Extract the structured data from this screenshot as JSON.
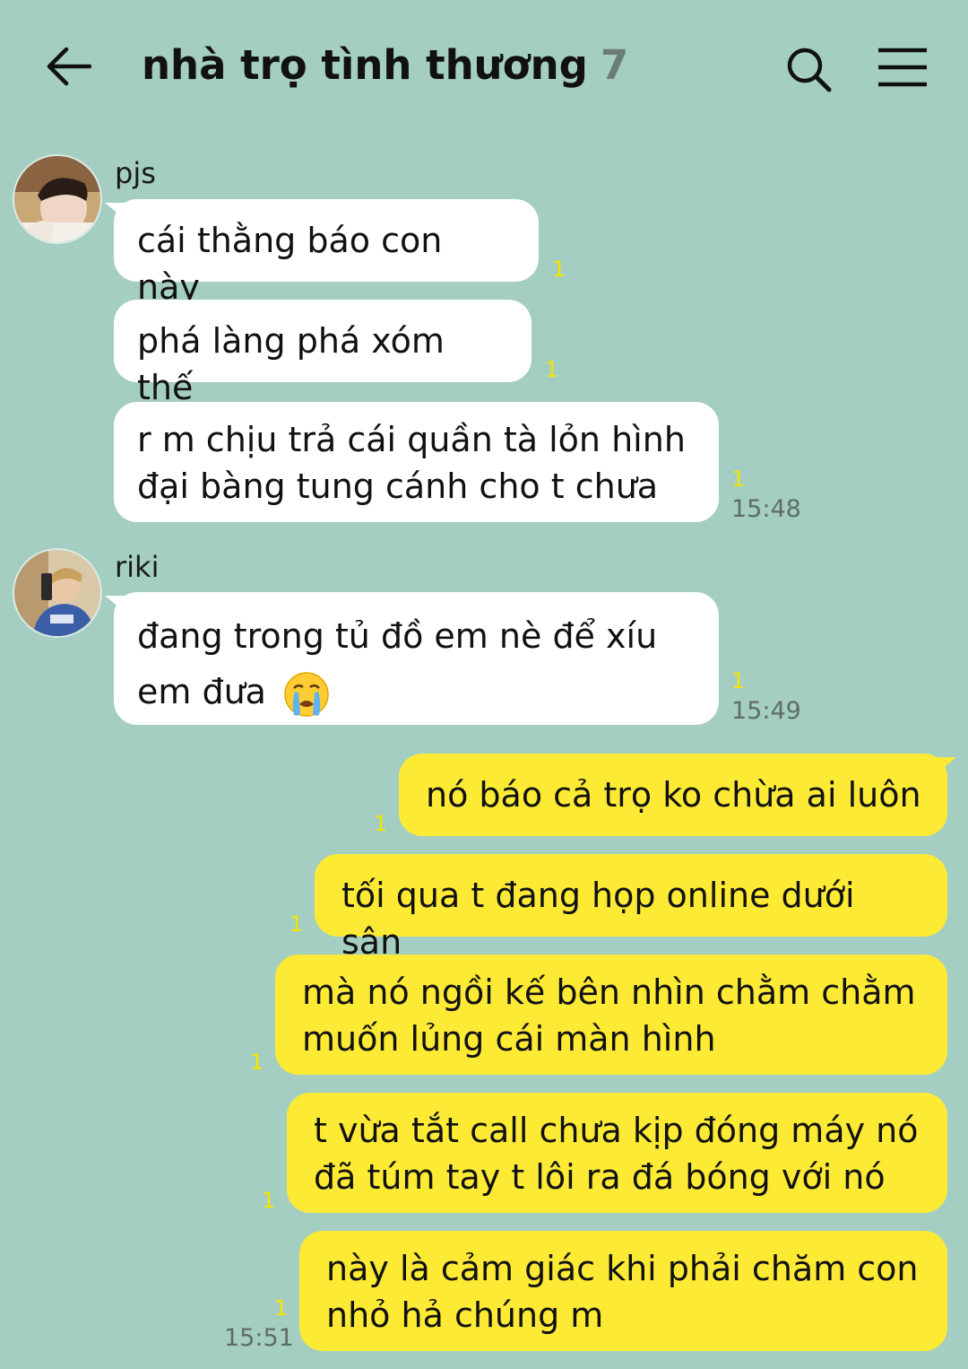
{
  "header": {
    "title": "nhà trọ tình thương",
    "member_count": "7",
    "back_icon": "arrow-left-icon",
    "search_icon": "search-icon",
    "menu_icon": "hamburger-menu-icon"
  },
  "colors": {
    "background": "#a4cec1",
    "incoming_bubble": "#ffffff",
    "outgoing_bubble": "#fdea35",
    "read_count": "#f5e400"
  },
  "senders": {
    "pjs": "pjs",
    "riki": "riki"
  },
  "messages": {
    "m1": {
      "text": "cái thằng báo con này",
      "read": "1"
    },
    "m2": {
      "text": "phá làng phá xóm thế",
      "read": "1"
    },
    "m3": {
      "line1": "r m chịu trả cái quần tà lỏn hình",
      "line2": "đại bàng tung cánh cho t chưa",
      "read": "1",
      "time": "15:48"
    },
    "m4": {
      "line1": "đang trong tủ đồ em nè để xíu",
      "line2": "em đưa",
      "emoji": "crying-face-emoji",
      "read": "1",
      "time": "15:49"
    },
    "m5": {
      "text": "nó báo cả trọ ko chừa ai luôn",
      "read": "1"
    },
    "m6": {
      "text": "tối qua t đang họp online dưới sân",
      "read": "1"
    },
    "m7": {
      "line1": "mà nó ngồi kế bên nhìn chằm chằm",
      "line2": "muốn lủng cái màn hình",
      "read": "1"
    },
    "m8": {
      "line1": "t vừa tắt call chưa kịp đóng máy nó",
      "line2": "đã túm tay t lôi ra đá bóng với nó",
      "read": "1"
    },
    "m9": {
      "line1": "này là cảm giác khi phải chăm con",
      "line2": "nhỏ hả chúng m",
      "read": "1",
      "time": "15:51"
    }
  }
}
